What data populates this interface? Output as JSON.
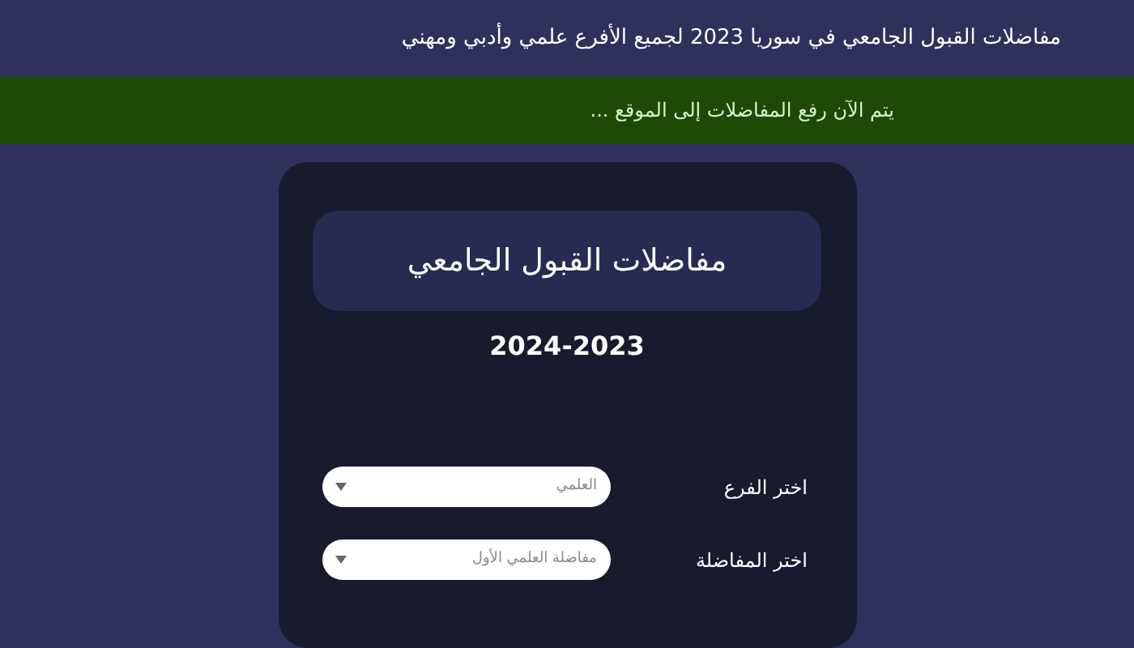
{
  "headline": "مفاضلات القبول الجامعي في سوريا 2023 لجميع الأفرع علمي وأدبي ومهني",
  "banner": "يتم الآن رفع المفاضلات إلى الموقع ...",
  "card": {
    "title": "مفاضلات القبول الجامعي",
    "year": "2024-2023",
    "fields": [
      {
        "label": "اختر الفرع",
        "value": "العلمي"
      },
      {
        "label": "اختر المفاضلة",
        "value": "مفاضلة العلمي الأول"
      }
    ]
  }
}
